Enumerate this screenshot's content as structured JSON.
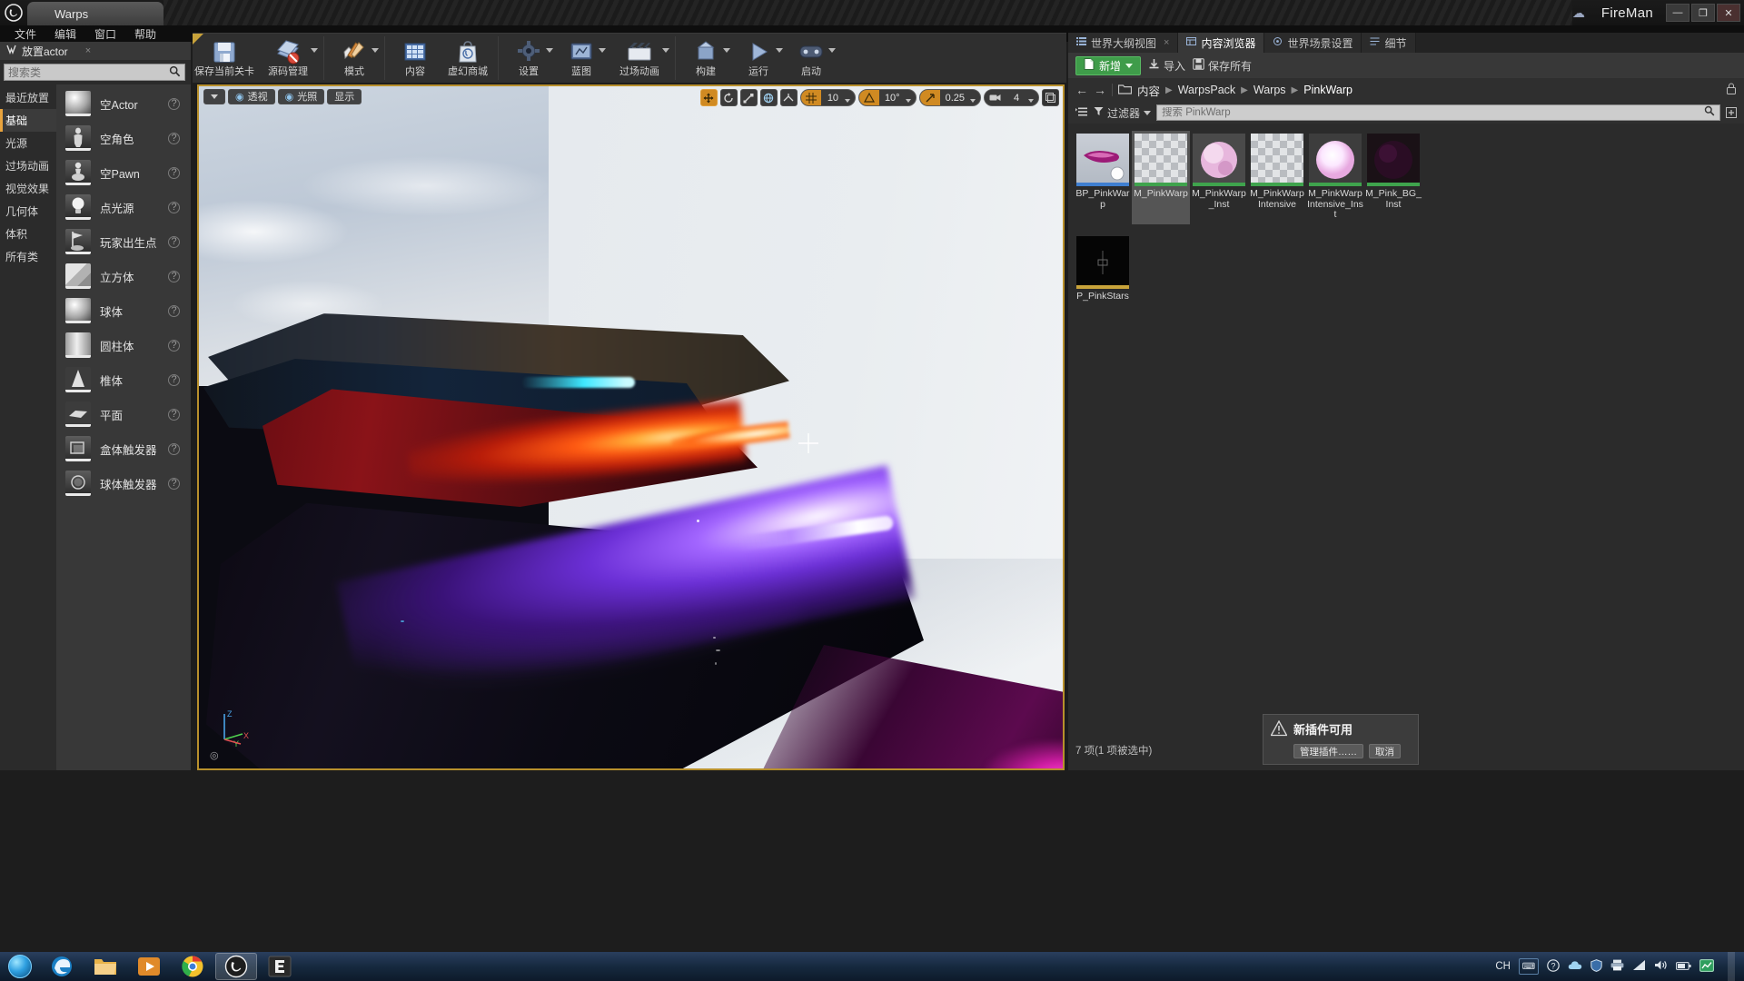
{
  "window": {
    "project_tab": "Warps",
    "user": "FireMan",
    "cloud_icon": "cloud-icon",
    "minimize": "—",
    "maximize": "❐",
    "close": "✕"
  },
  "menu": {
    "items": [
      {
        "label": "文件",
        "name": "menu-file"
      },
      {
        "label": "编辑",
        "name": "menu-edit"
      },
      {
        "label": "窗口",
        "name": "menu-window"
      },
      {
        "label": "帮助",
        "name": "menu-help"
      }
    ]
  },
  "place_panel": {
    "tab_label": "放置actor",
    "tab_close": "×",
    "search_placeholder": "搜索类",
    "search_value": "",
    "categories": [
      {
        "label": "最近放置",
        "active": false
      },
      {
        "label": "基础",
        "active": true
      },
      {
        "label": "光源",
        "active": false
      },
      {
        "label": "过场动画",
        "active": false
      },
      {
        "label": "视觉效果",
        "active": false
      },
      {
        "label": "几何体",
        "active": false
      },
      {
        "label": "体积",
        "active": false
      },
      {
        "label": "所有类",
        "active": false
      }
    ],
    "assets": [
      {
        "label": "空Actor",
        "thumb": "sphere"
      },
      {
        "label": "空角色",
        "thumb": "dark"
      },
      {
        "label": "空Pawn",
        "thumb": "dark"
      },
      {
        "label": "点光源",
        "thumb": "dark"
      },
      {
        "label": "玩家出生点",
        "thumb": "dark"
      },
      {
        "label": "立方体",
        "thumb": "cube"
      },
      {
        "label": "球体",
        "thumb": "sphere"
      },
      {
        "label": "圆柱体",
        "thumb": "cyl"
      },
      {
        "label": "椎体",
        "thumb": "cone"
      },
      {
        "label": "平面",
        "thumb": "plane"
      },
      {
        "label": "盒体触发器",
        "thumb": "dark"
      },
      {
        "label": "球体触发器",
        "thumb": "dark"
      }
    ],
    "help_glyph": "?"
  },
  "toolbar": {
    "buttons": [
      {
        "label": "保存当前关卡",
        "icon": "save-icon",
        "caret": false
      },
      {
        "label": "源码管理",
        "icon": "source-control-icon",
        "caret": true
      },
      {
        "label": "模式",
        "icon": "modes-icon",
        "caret": true
      },
      {
        "label": "内容",
        "icon": "content-icon",
        "caret": false
      },
      {
        "label": "虚幻商城",
        "icon": "marketplace-icon",
        "caret": false
      },
      {
        "label": "设置",
        "icon": "settings-icon",
        "caret": true
      },
      {
        "label": "蓝图",
        "icon": "blueprint-icon",
        "caret": true
      },
      {
        "label": "过场动画",
        "icon": "cinematics-icon",
        "caret": true
      },
      {
        "label": "构建",
        "icon": "build-icon",
        "caret": true
      },
      {
        "label": "运行",
        "icon": "play-icon",
        "caret": true
      },
      {
        "label": "启动",
        "icon": "launch-icon",
        "caret": true
      }
    ]
  },
  "viewport": {
    "left_controls": [
      {
        "label": "",
        "icon": "chevron-down-icon",
        "name": "viewport-options-menu"
      },
      {
        "label": "透视",
        "icon": "camera-icon",
        "name": "viewport-perspective-menu"
      },
      {
        "label": "光照",
        "icon": "lit-icon",
        "name": "viewport-lit-menu"
      },
      {
        "label": "显示",
        "icon": "show-icon",
        "name": "viewport-show-menu"
      }
    ],
    "transform_tools": [
      {
        "icon": "move-icon",
        "active": true
      },
      {
        "icon": "rotate-icon",
        "active": false
      },
      {
        "icon": "scale-icon",
        "active": false
      },
      {
        "icon": "world-icon",
        "active": false
      },
      {
        "icon": "surface-snap-icon",
        "active": false
      }
    ],
    "grid_snap": {
      "icon": "grid-icon",
      "value": "10",
      "active": true
    },
    "angle_snap": {
      "icon": "angle-icon",
      "value": "10°",
      "active": true
    },
    "scale_snap": {
      "icon": "scale-snap-icon",
      "value": "0.25",
      "active": true
    },
    "camera_speed": {
      "icon": "camera-speed-icon",
      "value": "4",
      "active": false
    },
    "maximize_icon": "maximize-viewport-icon",
    "axes": {
      "z": "Z",
      "y": "Y",
      "x": "X"
    }
  },
  "right_panel": {
    "tabs": [
      {
        "label": "世界大纲视图",
        "icon": "outliner-icon",
        "active": false,
        "close": "×"
      },
      {
        "label": "内容浏览器",
        "icon": "content-browser-icon",
        "active": true,
        "close": ""
      },
      {
        "label": "世界场景设置",
        "icon": "world-settings-icon",
        "active": false,
        "close": ""
      },
      {
        "label": "细节",
        "icon": "details-icon",
        "active": false,
        "close": ""
      }
    ],
    "content_browser": {
      "add_button": "新增",
      "import_button": "导入",
      "save_all_button": "保存所有",
      "breadcrumb": [
        "内容",
        "WarpsPack",
        "Warps",
        "PinkWarp"
      ],
      "filter_button": "过滤器",
      "search_placeholder": "搜索 PinkWarp",
      "search_value": "",
      "assets": [
        {
          "name": "BP_PinkWarp",
          "thumb": "blueprint-warp",
          "selected": false
        },
        {
          "name": "M_PinkWarp",
          "thumb": "material-checker",
          "selected": true
        },
        {
          "name": "M_PinkWarp_Inst",
          "thumb": "material-pink-sphere",
          "selected": false
        },
        {
          "name": "M_PinkWarp Intensive",
          "thumb": "material-checker",
          "selected": false
        },
        {
          "name": "M_PinkWarp Intensive_Inst",
          "thumb": "material-white-glow",
          "selected": false
        },
        {
          "name": "M_Pink_BG_Inst",
          "thumb": "material-dark-sphere",
          "selected": false
        },
        {
          "name": "P_PinkStars",
          "thumb": "particle-dark",
          "selected": false
        }
      ],
      "status": "7 项(1 项被选中)"
    }
  },
  "toast": {
    "icon": "warning-icon",
    "title": "新插件可用",
    "manage_button": "管理插件……",
    "cancel_button": "取消"
  },
  "taskbar": {
    "start_icon": "start-orb-icon",
    "apps": [
      {
        "icon": "edge-icon",
        "name": "taskbar-edge"
      },
      {
        "icon": "explorer-icon",
        "name": "taskbar-file-explorer"
      },
      {
        "icon": "media-icon",
        "name": "taskbar-media-player"
      },
      {
        "icon": "chrome-icon",
        "name": "taskbar-chrome"
      },
      {
        "icon": "unreal-icon",
        "name": "taskbar-unreal-editor",
        "active": true
      },
      {
        "icon": "epic-icon",
        "name": "taskbar-epic-games"
      }
    ],
    "ime": "CH",
    "tray_icons": [
      "keyboard-icon",
      "help-icon",
      "onedrive-icon",
      "shield-icon",
      "printer-icon",
      "network-icon",
      "sound-icon",
      "battery-icon",
      "chart-icon"
    ]
  }
}
